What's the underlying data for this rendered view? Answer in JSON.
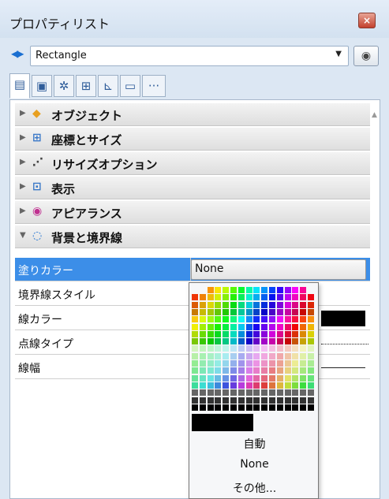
{
  "window": {
    "title": "プロパティリスト",
    "close_label": "×"
  },
  "selector": {
    "nav_icon": "left-right-arrows-icon",
    "value": "Rectangle",
    "eye_icon": "eye-icon"
  },
  "tabs": [
    {
      "name": "tab-properties",
      "glyph": "▤",
      "active": true
    },
    {
      "name": "tab-display",
      "glyph": "▣",
      "active": false
    },
    {
      "name": "tab-settings",
      "glyph": "✲",
      "active": false
    },
    {
      "name": "tab-shapes",
      "glyph": "⊞",
      "active": false
    },
    {
      "name": "tab-chart",
      "glyph": "⊾",
      "active": false
    },
    {
      "name": "tab-monitor",
      "glyph": "▭",
      "active": false
    },
    {
      "name": "tab-more",
      "glyph": "···",
      "active": false
    }
  ],
  "sections": [
    {
      "label": "オブジェクト",
      "icon": "cube-icon",
      "glyph": "◆",
      "color": "#e8a020",
      "expanded": false
    },
    {
      "label": "座標とサイズ",
      "icon": "coordinates-icon",
      "glyph": "⊞",
      "color": "#3a78c8",
      "expanded": false
    },
    {
      "label": "リサイズオプション",
      "icon": "resize-icon",
      "glyph": "⋰",
      "color": "#444444",
      "expanded": false
    },
    {
      "label": "表示",
      "icon": "display-icon",
      "glyph": "⊡",
      "color": "#3a78c8",
      "expanded": false
    },
    {
      "label": "アピアランス",
      "icon": "appearance-eye-icon",
      "glyph": "◉",
      "color": "#c03090",
      "expanded": false
    },
    {
      "label": "背景と境界線",
      "icon": "background-border-icon",
      "glyph": "◌",
      "color": "#1a6fd1",
      "expanded": true
    }
  ],
  "properties": [
    {
      "label": "塗りカラー",
      "value": "None",
      "selected": true
    },
    {
      "label": "境界線スタイル",
      "selected": false
    },
    {
      "label": "線カラー",
      "selected": false
    },
    {
      "label": "点線タイプ",
      "selected": false
    },
    {
      "label": "線幅",
      "selected": false
    }
  ],
  "color_popup": {
    "selected_color": "#000000",
    "items": [
      "自動",
      "None",
      "その他..."
    ]
  }
}
